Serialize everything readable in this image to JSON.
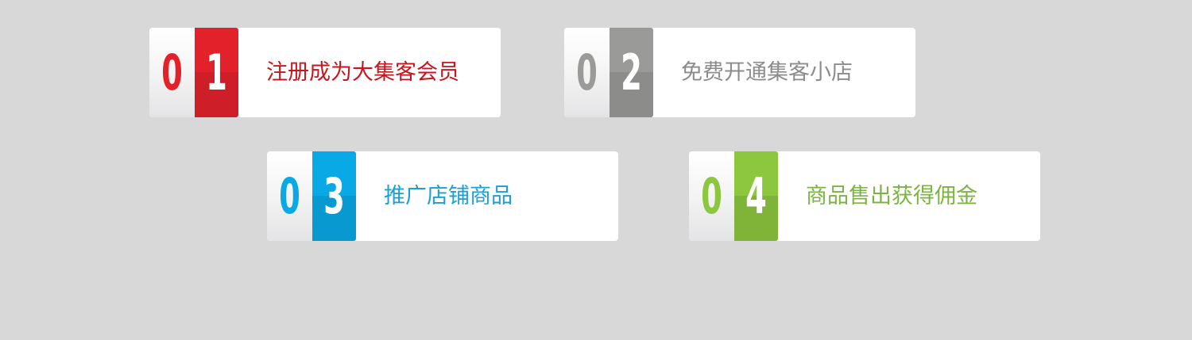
{
  "steps": [
    {
      "digit_first": "0",
      "digit_second": "1",
      "label": "注册成为大集客会员",
      "accent_color": "#e3212b",
      "label_color": "#c8161e"
    },
    {
      "digit_first": "0",
      "digit_second": "2",
      "label": "免费开通集客小店",
      "accent_color": "#9a9b99",
      "label_color": "#8c8c8c"
    },
    {
      "digit_first": "0",
      "digit_second": "3",
      "label": "推广店铺商品",
      "accent_color": "#09a9e5",
      "label_color": "#1a9fd6"
    },
    {
      "digit_first": "0",
      "digit_second": "4",
      "label": "商品售出获得佣金",
      "accent_color": "#8dc63f",
      "label_color": "#7cb342"
    }
  ]
}
